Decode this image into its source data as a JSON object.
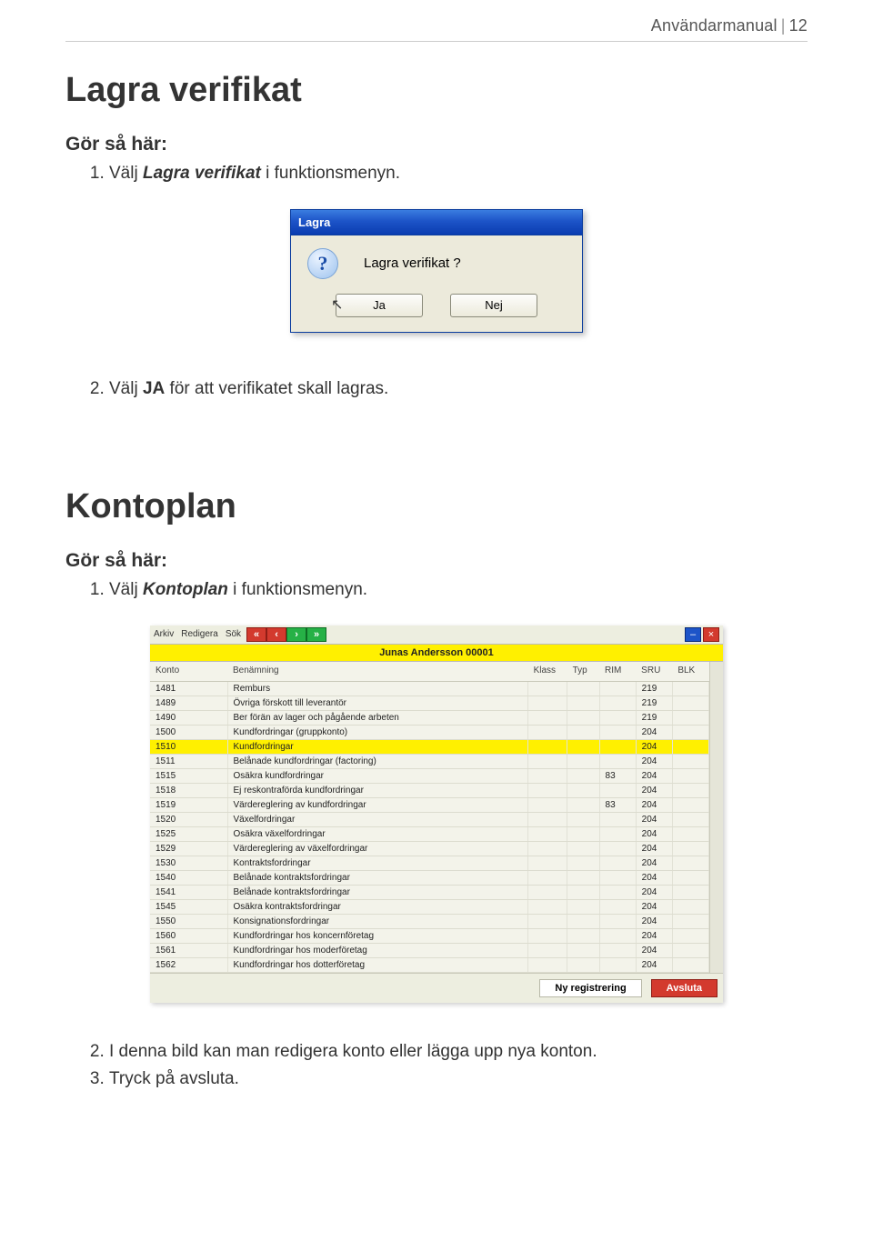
{
  "header": {
    "title": "Användarmanual",
    "page_no": "12"
  },
  "section_lagra": {
    "title": "Lagra verifikat",
    "subheading": "Gör så här:",
    "step1_prefix": "Välj ",
    "step1_em": "Lagra verifikat",
    "step1_suffix": " i funktionsmenyn.",
    "step2_prefix": "Välj ",
    "step2_bold": "JA",
    "step2_suffix": " för att verifikatet skall lagras."
  },
  "dialog": {
    "title": "Lagra",
    "message": "Lagra verifikat ?",
    "yes": "Ja",
    "no": "Nej"
  },
  "section_kontoplan": {
    "title": "Kontoplan",
    "subheading": "Gör så här:",
    "step1_prefix": "Välj ",
    "step1_em": "Kontoplan",
    "step1_suffix": " i funktionsmenyn.",
    "step2": "I denna bild kan man redigera konto eller lägga upp nya konton.",
    "step3": "Tryck på avsluta."
  },
  "kontoplan": {
    "menu": {
      "arkiv": "Arkiv",
      "redigera": "Redigera",
      "sok": "Sök"
    },
    "owner": "Junas Andersson 00001",
    "headers": {
      "konto": "Konto",
      "benamning": "Benämning",
      "klass": "Klass",
      "typ": "Typ",
      "rim": "RIM",
      "sru": "SRU",
      "blk": "BLK"
    },
    "rows": [
      {
        "konto": "1481",
        "benamning": "Remburs",
        "sru": "219",
        "rim": ""
      },
      {
        "konto": "1489",
        "benamning": "Övriga förskott till leverantör",
        "sru": "219",
        "rim": ""
      },
      {
        "konto": "1490",
        "benamning": "Ber förän av lager och pågående arbeten",
        "sru": "219",
        "rim": ""
      },
      {
        "konto": "1500",
        "benamning": "Kundfordringar (gruppkonto)",
        "sru": "204",
        "rim": ""
      },
      {
        "konto": "1510",
        "benamning": "Kundfordringar",
        "sru": "204",
        "rim": "",
        "hl": true
      },
      {
        "konto": "1511",
        "benamning": "Belånade kundfordringar (factoring)",
        "sru": "204",
        "rim": ""
      },
      {
        "konto": "1515",
        "benamning": "Osäkra kundfordringar",
        "sru": "204",
        "rim": "83"
      },
      {
        "konto": "1518",
        "benamning": "Ej reskontraförda kundfordringar",
        "sru": "204",
        "rim": ""
      },
      {
        "konto": "1519",
        "benamning": "Värdereglering av kundfordringar",
        "sru": "204",
        "rim": "83"
      },
      {
        "konto": "1520",
        "benamning": "Växelfordringar",
        "sru": "204",
        "rim": ""
      },
      {
        "konto": "1525",
        "benamning": "Osäkra växelfordringar",
        "sru": "204",
        "rim": ""
      },
      {
        "konto": "1529",
        "benamning": "Värdereglering av växelfordringar",
        "sru": "204",
        "rim": ""
      },
      {
        "konto": "1530",
        "benamning": "Kontraktsfordringar",
        "sru": "204",
        "rim": ""
      },
      {
        "konto": "1540",
        "benamning": "Belånade kontraktsfordringar",
        "sru": "204",
        "rim": ""
      },
      {
        "konto": "1541",
        "benamning": "Belånade kontraktsfordringar",
        "sru": "204",
        "rim": ""
      },
      {
        "konto": "1545",
        "benamning": "Osäkra kontraktsfordringar",
        "sru": "204",
        "rim": ""
      },
      {
        "konto": "1550",
        "benamning": "Konsignationsfordringar",
        "sru": "204",
        "rim": ""
      },
      {
        "konto": "1560",
        "benamning": "Kundfordringar hos koncernföretag",
        "sru": "204",
        "rim": ""
      },
      {
        "konto": "1561",
        "benamning": "Kundfordringar hos moderföretag",
        "sru": "204",
        "rim": ""
      },
      {
        "konto": "1562",
        "benamning": "Kundfordringar hos dotterföretag",
        "sru": "204",
        "rim": ""
      }
    ],
    "buttons": {
      "new": "Ny registrering",
      "close": "Avsluta"
    }
  }
}
